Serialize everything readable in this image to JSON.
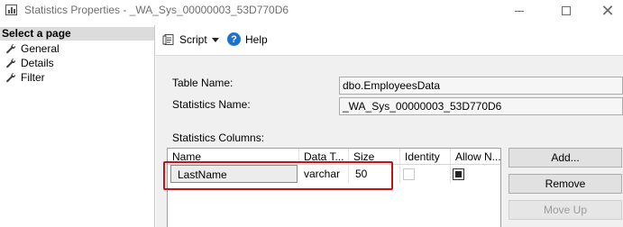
{
  "window": {
    "title": "Statistics Properties - _WA_Sys_00000003_53D770D6"
  },
  "left_pane": {
    "header": "Select a page",
    "pages": [
      {
        "label": "General",
        "icon": "wrench-icon"
      },
      {
        "label": "Details",
        "icon": "wrench-icon"
      },
      {
        "label": "Filter",
        "icon": "wrench-icon"
      }
    ]
  },
  "toolbar": {
    "script_label": "Script",
    "help_label": "Help"
  },
  "form": {
    "table_name_label": "Table Name:",
    "table_name_value": "dbo.EmployeesData",
    "statistics_name_label": "Statistics Name:",
    "statistics_name_value": "_WA_Sys_00000003_53D770D6",
    "statistics_columns_label": "Statistics Columns:"
  },
  "grid": {
    "columns": [
      "Name",
      "Data T...",
      "Size",
      "Identity",
      "Allow N..."
    ],
    "rows": [
      {
        "name": "LastName",
        "data_type": "varchar",
        "size": "50",
        "identity": false,
        "allow_nulls": true
      }
    ]
  },
  "buttons": {
    "add": "Add...",
    "remove": "Remove",
    "move_up": "Move Up"
  },
  "colors": {
    "highlight_outline": "#c0141b",
    "help_icon": "#1e73c9"
  }
}
